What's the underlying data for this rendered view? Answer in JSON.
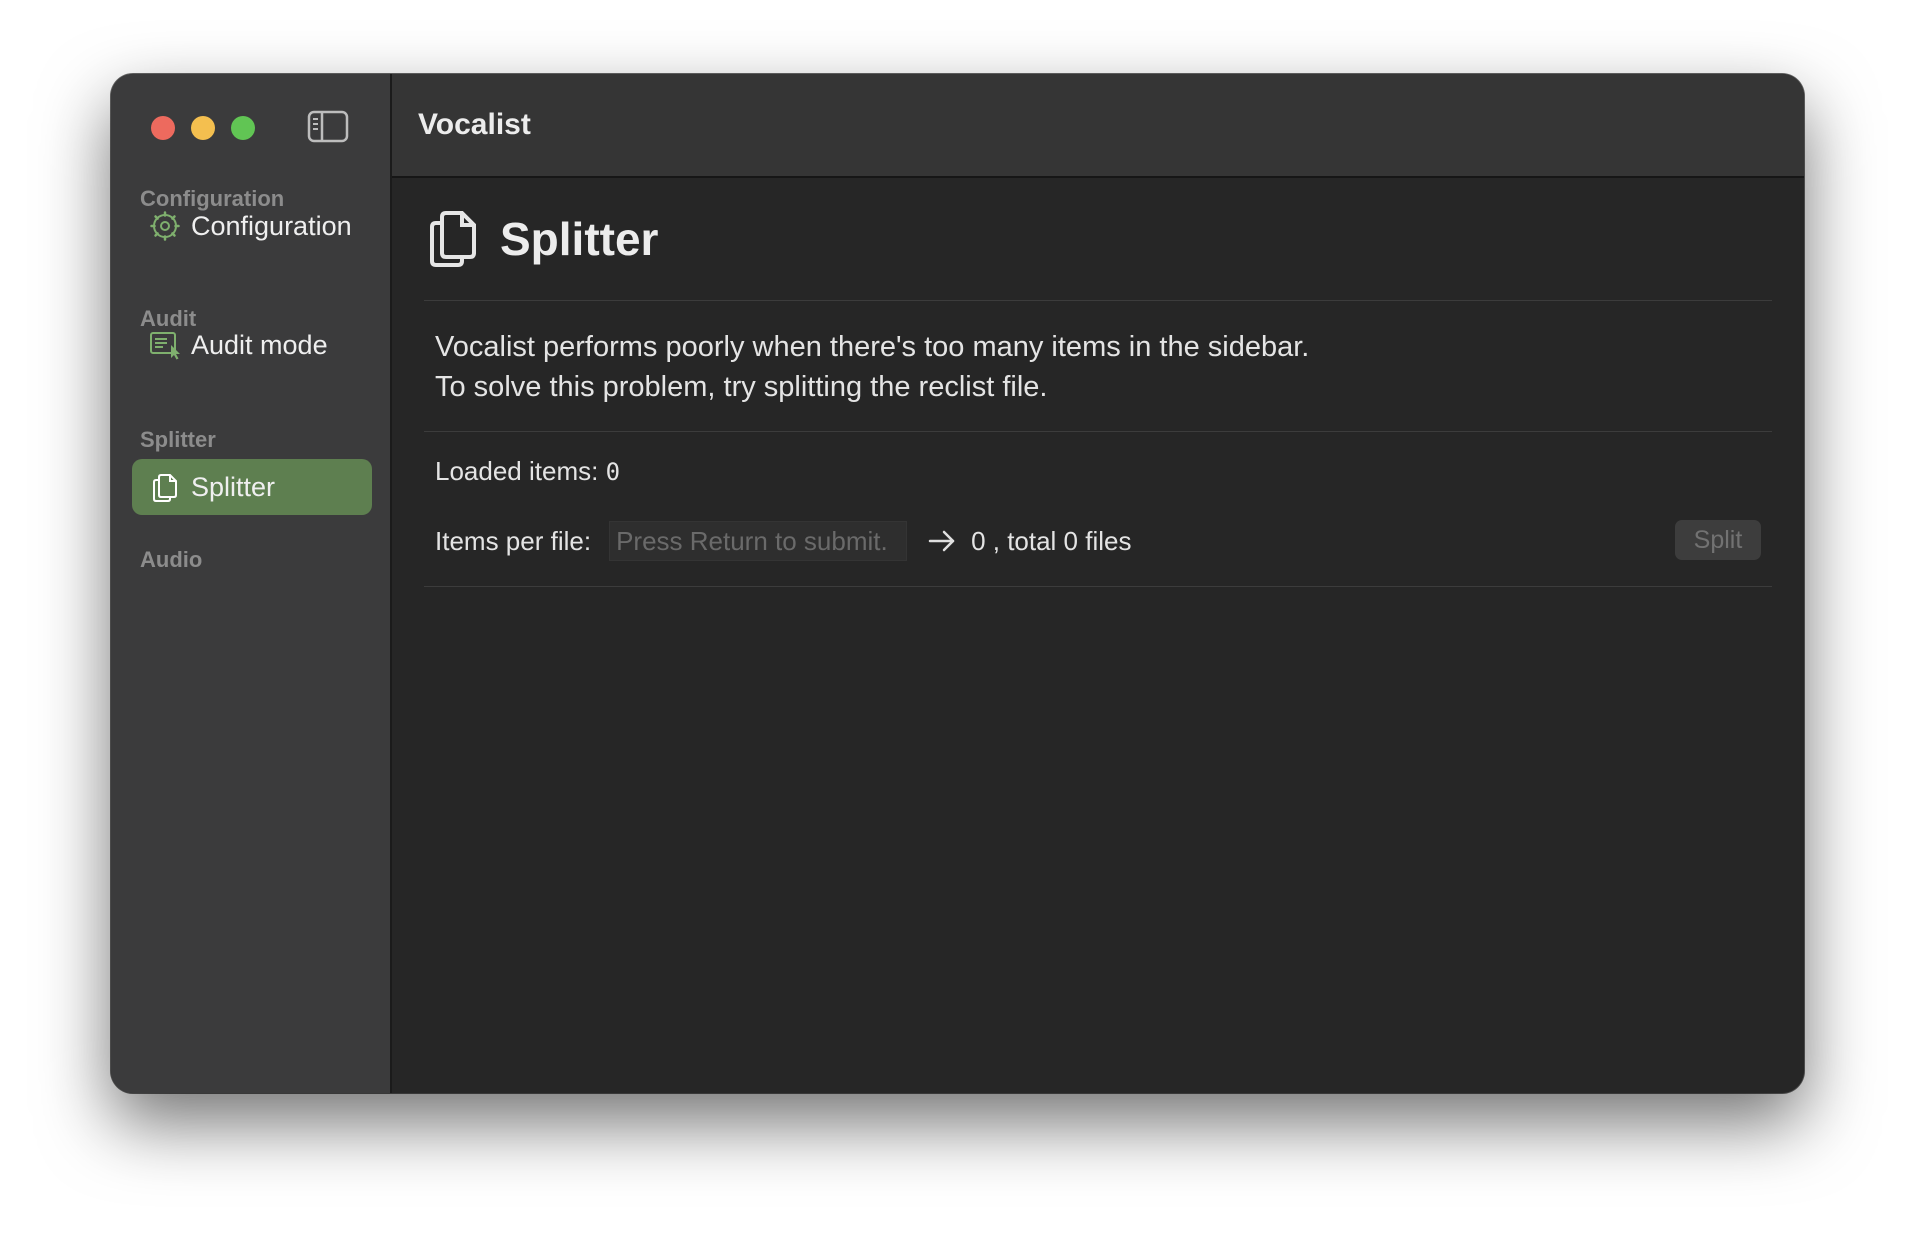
{
  "window": {
    "title": "Vocalist",
    "traffic_lights": {
      "close": "#ed6a5e",
      "minimize": "#f4bf4f",
      "zoom": "#61c554"
    }
  },
  "colors": {
    "accent_green": "#5e7f50",
    "icon_green": "#7fb06e",
    "sidebar_bg": "#3b3b3c",
    "content_bg": "#262626"
  },
  "sidebar": {
    "toggle_icon": "sidebar-toggle-icon",
    "sections": [
      {
        "header": "Configuration",
        "items": [
          {
            "label": "Configuration",
            "icon": "gear-icon",
            "selected": false
          }
        ]
      },
      {
        "header": "Audit",
        "items": [
          {
            "label": "Audit mode",
            "icon": "audit-list-icon",
            "selected": false
          }
        ]
      },
      {
        "header": "Splitter",
        "items": [
          {
            "label": "Splitter",
            "icon": "documents-icon",
            "selected": true
          }
        ]
      },
      {
        "header": "Audio",
        "items": []
      }
    ]
  },
  "main": {
    "heading": {
      "title": "Splitter",
      "icon": "documents-icon"
    },
    "description": [
      "Vocalist performs poorly when there's too many items in the sidebar.",
      "To solve this problem, try splitting the reclist file."
    ],
    "loaded_label": "Loaded items:",
    "loaded_value": "0",
    "items_per_file_label": "Items per file:",
    "items_per_file_value": "",
    "items_per_file_placeholder": "Press Return to submit.",
    "arrow_icon": "arrow-right-icon",
    "result_text": "0 , total 0 files",
    "split_button": "Split"
  }
}
